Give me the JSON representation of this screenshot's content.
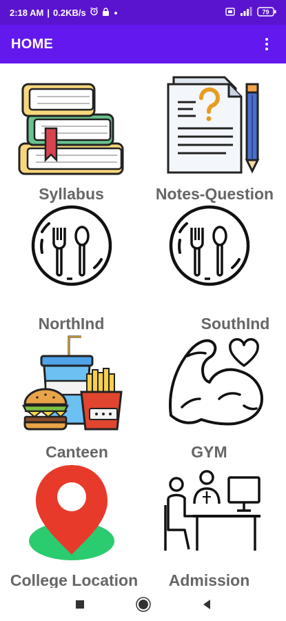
{
  "status_bar": {
    "time": "2:18 AM",
    "network_speed": "0.2KB/s",
    "battery": "79",
    "icons": [
      "alarm-icon",
      "lock-icon",
      "dot-icon",
      "sim-icon",
      "signal-icon",
      "battery-icon"
    ]
  },
  "app_bar": {
    "title": "HOME",
    "menu_icon": "more-vert-icon"
  },
  "tiles": [
    {
      "label": "Syllabus",
      "icon": "books-icon"
    },
    {
      "label": "Notes-Question",
      "icon": "notes-question-icon"
    },
    {
      "label": "NorthInd",
      "icon": "plate-fork-spoon-icon"
    },
    {
      "label": "SouthInd",
      "icon": "plate-fork-spoon-icon"
    },
    {
      "label": "Canteen",
      "icon": "fast-food-icon"
    },
    {
      "label": "GYM",
      "icon": "muscle-heart-icon"
    },
    {
      "label": "College Location",
      "icon": "location-pin-icon"
    },
    {
      "label": "Admission",
      "icon": "admission-desk-icon"
    }
  ],
  "nav_bar": {
    "icons": [
      "recents-icon",
      "home-icon",
      "back-icon"
    ]
  },
  "colors": {
    "status_bar": "#5a14cf",
    "app_bar": "#6318ee",
    "label_text": "#666666",
    "pin_red": "#e83a2a",
    "ground_green": "#2bcb6f"
  }
}
